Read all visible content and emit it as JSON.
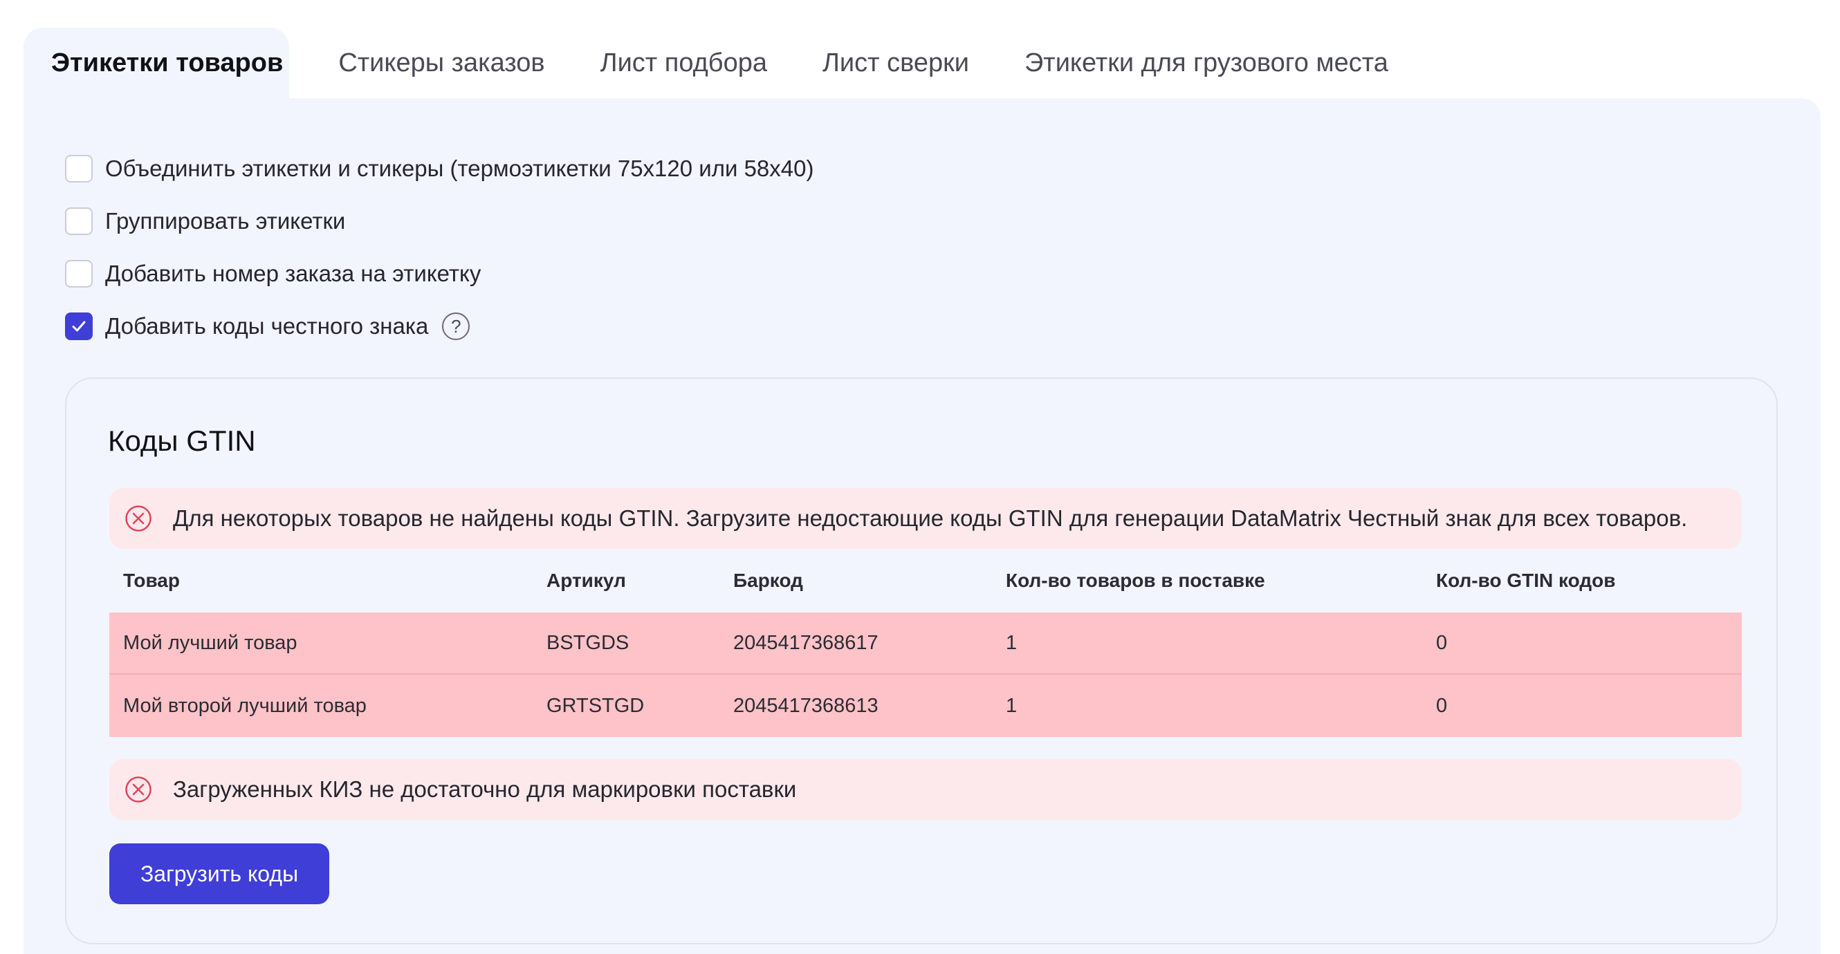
{
  "tabs": [
    {
      "label": "Этикетки товаров",
      "active": true
    },
    {
      "label": "Стикеры заказов",
      "active": false
    },
    {
      "label": "Лист подбора",
      "active": false
    },
    {
      "label": "Лист сверки",
      "active": false
    },
    {
      "label": "Этикетки для грузового места",
      "active": false
    }
  ],
  "options": [
    {
      "label": "Объединить этикетки и стикеры (термоэтикетки 75х120 или 58х40)",
      "checked": false
    },
    {
      "label": "Группировать этикетки",
      "checked": false
    },
    {
      "label": "Добавить номер заказа на этикетку",
      "checked": false
    },
    {
      "label": "Добавить коды честного знака",
      "checked": true
    }
  ],
  "help_icon": "?",
  "gtin": {
    "title": "Коды GTIN",
    "alert_missing": "Для некоторых товаров не найдены коды GTIN. Загрузите недостающие коды GTIN для генерации DataMatrix Честный знак для всех товаров.",
    "table": {
      "columns": [
        "Товар",
        "Артикул",
        "Баркод",
        "Кол-во товаров в поставке",
        "Кол-во GTIN кодов"
      ],
      "rows": [
        [
          "Мой лучший товар",
          "BSTGDS",
          "2045417368617",
          "1",
          "0"
        ],
        [
          "Мой второй лучший товар",
          "GRTSTGD",
          "2045417368613",
          "1",
          "0"
        ]
      ]
    },
    "alert_kiz": "Загруженных КИЗ не достаточно для маркировки поставки",
    "upload_button": "Загрузить коды"
  },
  "colors": {
    "accent": "#3f3ed6",
    "panel_bg": "#f2f5fd",
    "alert_bg": "#fde9ec",
    "error_row_bg": "#fec3c8",
    "error_icon": "#e0445a"
  }
}
